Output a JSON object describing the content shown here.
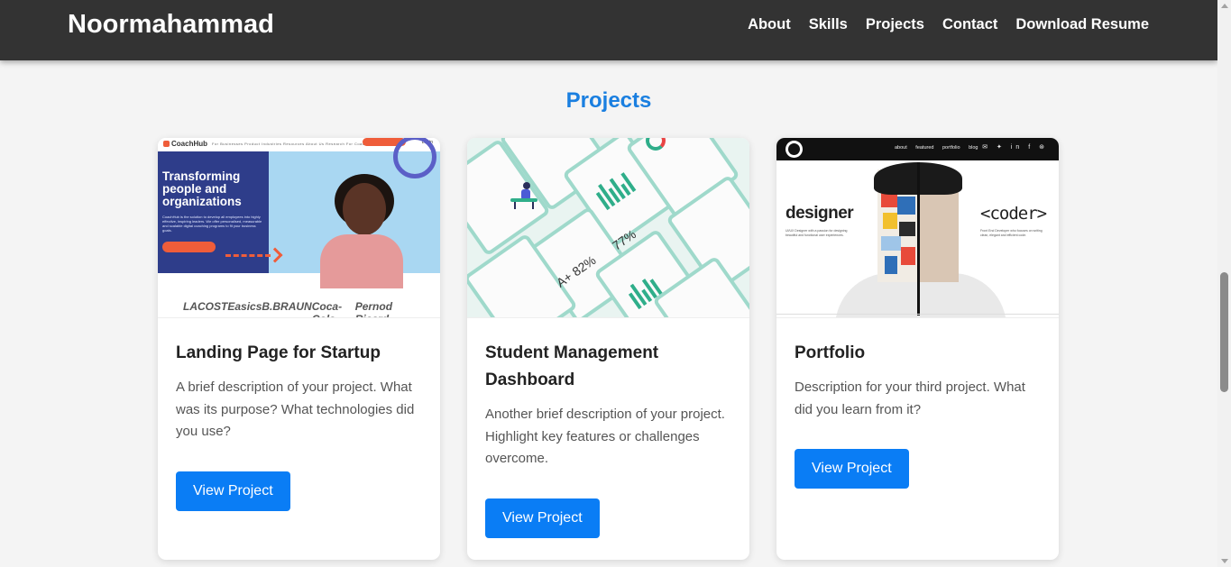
{
  "header": {
    "brand": "Noormahammad",
    "nav": [
      {
        "label": "About"
      },
      {
        "label": "Skills"
      },
      {
        "label": "Projects"
      },
      {
        "label": "Contact"
      },
      {
        "label": "Download Resume"
      }
    ]
  },
  "section": {
    "title": "Projects"
  },
  "projects": [
    {
      "title": "Landing Page for Startup",
      "description": "A brief description of your project. What was its purpose? What technologies did you use?",
      "button": "View Project",
      "thumbnail": {
        "brand": "CoachHub",
        "headline": "Transforming people and organizations",
        "body": "CoachHub is the solution to develop all employees into highly effective, inspiring leaders. We offer personalised, measurable and scalable digital coaching programs to fit your business goals.",
        "nav": "For Businesses  Product  Industries  Resources  About Us  Research  For Coaches",
        "login": "Login",
        "logos": [
          "LACOSTE",
          "asics",
          "B.BRAUN",
          "Coca-Cola",
          "Pernod Ricard"
        ]
      }
    },
    {
      "title": "Student Management Dashboard",
      "description": "Another brief description of your project. Highlight key features or challenges overcome.",
      "button": "View Project",
      "thumbnail": {
        "stats": [
          "77%",
          "A+ 82%"
        ]
      }
    },
    {
      "title": "Portfolio",
      "description": "Description for your third project. What did you learn from it?",
      "button": "View Project",
      "thumbnail": {
        "left_word": "designer",
        "right_word": "<coder>",
        "nav": "about featured portfolio blog",
        "left_text": "UI/UX Designer with a passion for designing beautiful and functional user experiences.",
        "right_text": "Front End Developer who focuses on writing clean, elegant and efficient code."
      }
    }
  ],
  "colors": {
    "navbar": "#333333",
    "accent": "#0a7df5",
    "title": "#1a7fe0",
    "background": "#f4f4f4"
  }
}
